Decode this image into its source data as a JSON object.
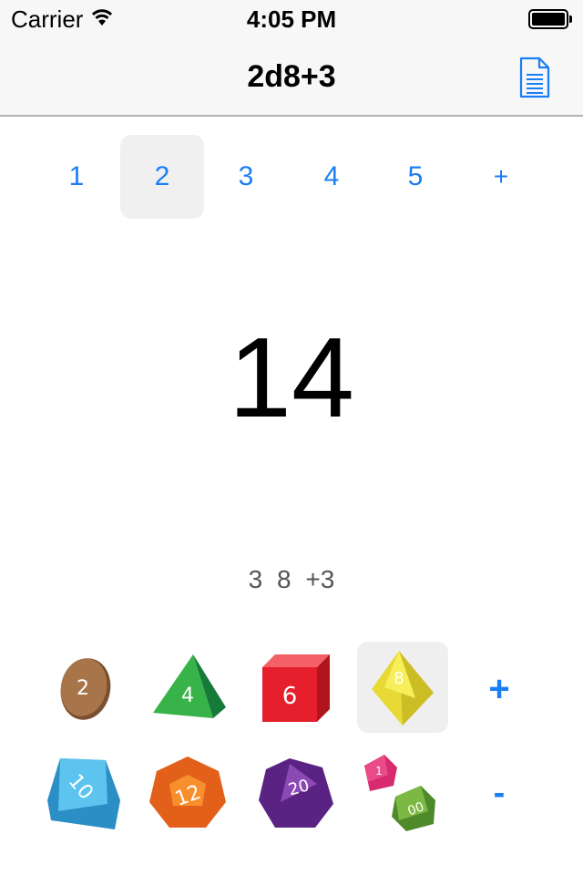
{
  "status_bar": {
    "carrier": "Carrier",
    "time": "4:05 PM"
  },
  "nav": {
    "title": "2d8+3",
    "right_icon": "document-icon"
  },
  "dice_count": {
    "options": [
      "1",
      "2",
      "3",
      "4",
      "5"
    ],
    "selected": "2",
    "more_label": "+"
  },
  "result": {
    "total": "14",
    "breakdown": [
      "3",
      "8",
      "+3"
    ]
  },
  "dice": [
    {
      "label": "2",
      "name": "d2",
      "color": "#9b6b42"
    },
    {
      "label": "4",
      "name": "d4",
      "color": "#2fb04c"
    },
    {
      "label": "6",
      "name": "d6",
      "color": "#e51f2b"
    },
    {
      "label": "8",
      "name": "d8",
      "color": "#efe236",
      "selected": true
    },
    {
      "label": "10",
      "name": "d10",
      "color": "#4ab8e4"
    },
    {
      "label": "12",
      "name": "d12",
      "color": "#f47b1f"
    },
    {
      "label": "20",
      "name": "d20",
      "color": "#6a2d93"
    },
    {
      "label": "1",
      "label2": "00",
      "name": "d100",
      "color": "#d82a6f",
      "color2": "#6aa53a"
    }
  ],
  "modifier": {
    "plus_label": "+",
    "minus_label": "-"
  }
}
